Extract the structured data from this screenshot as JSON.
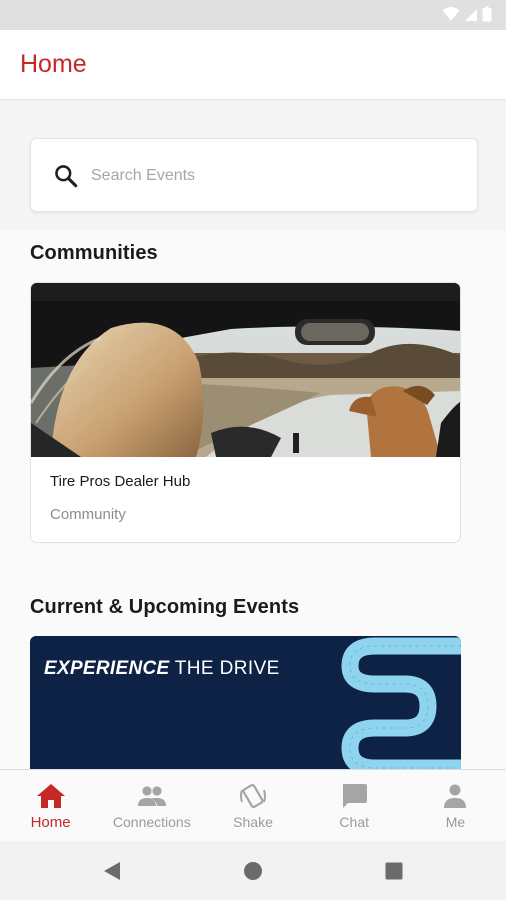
{
  "app": {
    "title": "Home"
  },
  "status_bar": {
    "icons": [
      "wifi-icon",
      "signal-icon",
      "battery-icon"
    ]
  },
  "search": {
    "placeholder": "Search Events",
    "value": "",
    "icon": "search-icon"
  },
  "sections": {
    "communities": "Communities",
    "events": "Current & Upcoming Events"
  },
  "communities": [
    {
      "name": "Tire Pros Dealer Hub",
      "type": "Community"
    }
  ],
  "events": [
    {
      "banner_bold": "EXPERIENCE",
      "banner_regular": "THE DRIVE"
    }
  ],
  "bottom_nav": [
    {
      "label": "Home",
      "icon": "home-icon",
      "active": true
    },
    {
      "label": "Connections",
      "icon": "people-icon",
      "active": false
    },
    {
      "label": "Shake",
      "icon": "shake-phone-icon",
      "active": false
    },
    {
      "label": "Chat",
      "icon": "chat-icon",
      "active": false
    },
    {
      "label": "Me",
      "icon": "person-icon",
      "active": false
    }
  ],
  "system_nav": [
    "back-icon",
    "home-circle-icon",
    "recents-icon"
  ],
  "colors": {
    "accent": "#c62828",
    "banner_bg": "#0e2245",
    "road_curve": "#8fd4ef",
    "inactive": "#9a9a9a"
  }
}
